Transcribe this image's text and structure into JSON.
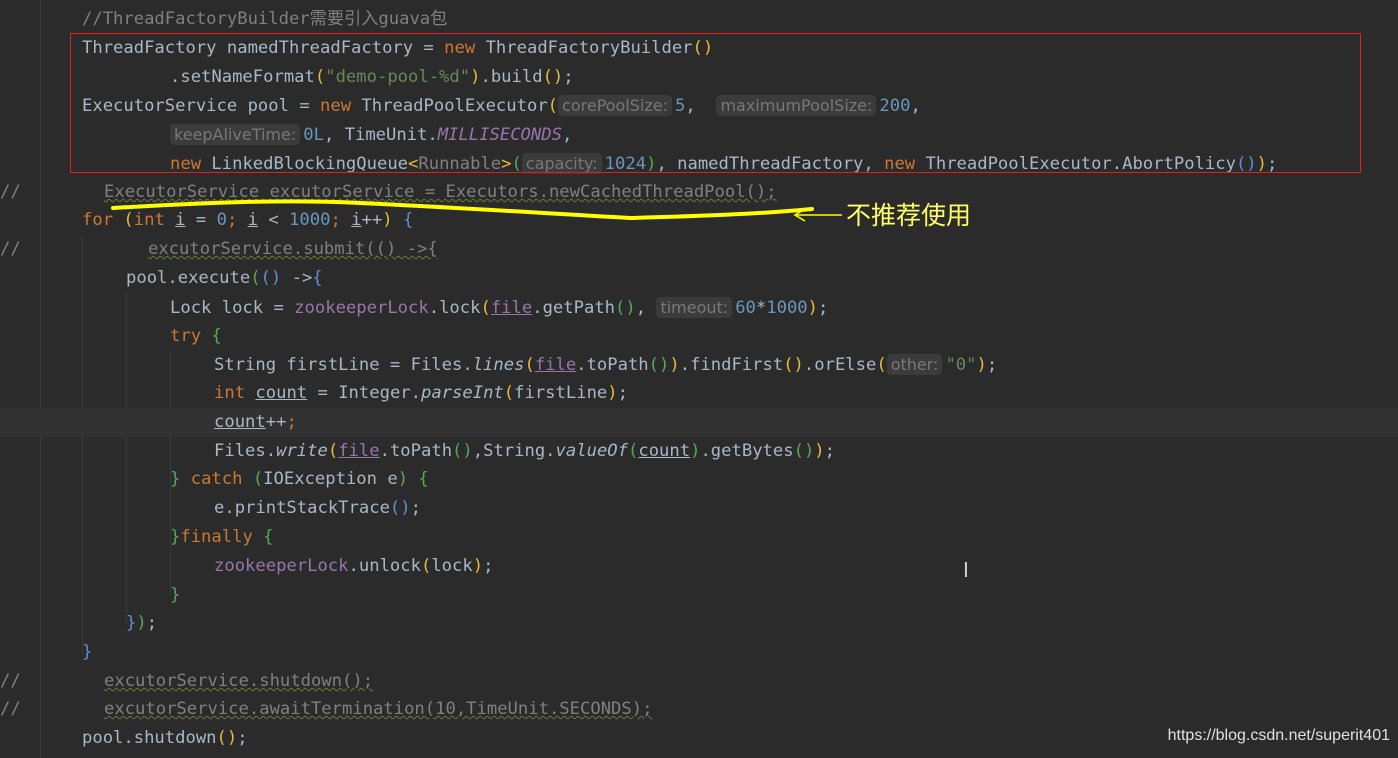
{
  "editor": {
    "lines": [
      {
        "id": "l1",
        "gutter": "",
        "tokens": [
          [
            "c",
            "//ThreadFactoryBuilder需要引入guava包"
          ]
        ]
      },
      {
        "id": "l2",
        "gutter": "",
        "tokens": [
          [
            "t",
            "ThreadFactory namedThreadFactory = "
          ],
          [
            "k",
            "new "
          ],
          [
            "t",
            "ThreadFactoryBuilder"
          ],
          [
            "p1",
            "()"
          ]
        ]
      },
      {
        "id": "l3",
        "gutter": "",
        "tokens": [
          [
            "t",
            ".setNameFormat"
          ],
          [
            "p1",
            "("
          ],
          [
            "s",
            "\"demo-pool-%d\""
          ],
          [
            "p1",
            ")"
          ],
          [
            "t",
            ".build"
          ],
          [
            "p1",
            "()"
          ],
          [
            "t",
            ";"
          ]
        ]
      },
      {
        "id": "l4",
        "gutter": "",
        "tokens": [
          [
            "t",
            "ExecutorService pool = "
          ],
          [
            "k",
            "new "
          ],
          [
            "t",
            "ThreadPoolExecutor"
          ],
          [
            "p1",
            "("
          ],
          [
            "h",
            "corePoolSize:"
          ],
          [
            "n",
            "5"
          ],
          [
            "t",
            ",  "
          ],
          [
            "h",
            "maximumPoolSize:"
          ],
          [
            "n",
            "200"
          ],
          [
            "t",
            ","
          ]
        ]
      },
      {
        "id": "l5",
        "gutter": "",
        "tokens": [
          [
            "h",
            "keepAliveTime:"
          ],
          [
            "n",
            "0L"
          ],
          [
            "t",
            ", TimeUnit."
          ],
          [
            "cst",
            "MILLISECONDS"
          ],
          [
            "t",
            ","
          ]
        ]
      },
      {
        "id": "l6",
        "gutter": "",
        "tokens": [
          [
            "k",
            "new "
          ],
          [
            "t",
            "LinkedBlockingQueue"
          ],
          [
            "p1",
            "<"
          ],
          [
            "c",
            "Runnable"
          ],
          [
            "p1",
            ">"
          ],
          [
            "p2",
            "("
          ],
          [
            "h",
            "capacity:"
          ],
          [
            "n",
            "1024"
          ],
          [
            "p2",
            ")"
          ],
          [
            "t",
            ", namedThreadFactory, "
          ],
          [
            "k",
            "new "
          ],
          [
            "t",
            "ThreadPoolExecutor.AbortPolicy"
          ],
          [
            "p3",
            "()"
          ],
          [
            "p1",
            ")"
          ],
          [
            "t",
            ";"
          ]
        ]
      },
      {
        "id": "l7",
        "gutter": "//",
        "tokens": [
          [
            "c",
            "ExecutorService excutorService = Executors.newCachedThreadPool();"
          ]
        ]
      },
      {
        "id": "l8",
        "gutter": "",
        "tokens": [
          [
            "k",
            "for "
          ],
          [
            "p1",
            "("
          ],
          [
            "k",
            "int "
          ],
          [
            "u",
            "i"
          ],
          [
            "t",
            " = "
          ],
          [
            "n",
            "0"
          ],
          [
            "k",
            "; "
          ],
          [
            "u",
            "i"
          ],
          [
            "t",
            " < "
          ],
          [
            "n",
            "1000"
          ],
          [
            "k",
            "; "
          ],
          [
            "u",
            "i"
          ],
          [
            "t",
            "++"
          ],
          [
            "p1",
            ")"
          ],
          [
            "t",
            " "
          ],
          [
            "p3",
            "{"
          ]
        ]
      },
      {
        "id": "l9",
        "gutter": "//",
        "tokens": [
          [
            "c",
            "excutorService.submit(() ->{"
          ]
        ]
      },
      {
        "id": "l10",
        "gutter": "",
        "tokens": [
          [
            "t",
            "pool.execute"
          ],
          [
            "p2",
            "("
          ],
          [
            "p3",
            "()"
          ],
          [
            "t",
            " ->"
          ],
          [
            "p3",
            "{"
          ]
        ]
      },
      {
        "id": "l11",
        "gutter": "",
        "tokens": [
          [
            "t",
            "Lock lock = "
          ],
          [
            "f",
            "zookeeperLock"
          ],
          [
            "t",
            ".lock"
          ],
          [
            "p1",
            "("
          ],
          [
            "fu",
            "file"
          ],
          [
            "t",
            ".getPath"
          ],
          [
            "p2",
            "()"
          ],
          [
            "t",
            ", "
          ],
          [
            "h",
            "timeout:"
          ],
          [
            "n",
            "60"
          ],
          [
            "t",
            "*"
          ],
          [
            "n",
            "1000"
          ],
          [
            "p1",
            ")"
          ],
          [
            "t",
            ";"
          ]
        ]
      },
      {
        "id": "l12",
        "gutter": "",
        "tokens": [
          [
            "k",
            "try "
          ],
          [
            "p2",
            "{"
          ]
        ]
      },
      {
        "id": "l13",
        "gutter": "",
        "tokens": [
          [
            "t",
            "String firstLine = Files."
          ],
          [
            "it",
            "lines"
          ],
          [
            "p1",
            "("
          ],
          [
            "fu",
            "file"
          ],
          [
            "t",
            ".toPath"
          ],
          [
            "p2",
            "()"
          ],
          [
            "p1",
            ")"
          ],
          [
            "t",
            ".findFirst"
          ],
          [
            "p1",
            "()"
          ],
          [
            "t",
            ".orElse"
          ],
          [
            "p1",
            "("
          ],
          [
            "h",
            "other:"
          ],
          [
            "s",
            "\"0\""
          ],
          [
            "p1",
            ")"
          ],
          [
            "t",
            ";"
          ]
        ]
      },
      {
        "id": "l14",
        "gutter": "",
        "tokens": [
          [
            "k",
            "int "
          ],
          [
            "u",
            "count"
          ],
          [
            "t",
            " = Integer."
          ],
          [
            "it",
            "parseInt"
          ],
          [
            "p1",
            "("
          ],
          [
            "t",
            "firstLine"
          ],
          [
            "p1",
            ")"
          ],
          [
            "t",
            ";"
          ]
        ]
      },
      {
        "id": "l15",
        "gutter": "",
        "tokens": [
          [
            "u",
            "count"
          ],
          [
            "t",
            "++"
          ],
          [
            "k",
            ";"
          ]
        ]
      },
      {
        "id": "l16",
        "gutter": "",
        "tokens": [
          [
            "t",
            "Files."
          ],
          [
            "it",
            "write"
          ],
          [
            "p1",
            "("
          ],
          [
            "fu",
            "file"
          ],
          [
            "t",
            ".toPath"
          ],
          [
            "p2",
            "()"
          ],
          [
            "t",
            ",String."
          ],
          [
            "it",
            "valueOf"
          ],
          [
            "p2",
            "("
          ],
          [
            "u",
            "count"
          ],
          [
            "p2",
            ")"
          ],
          [
            "t",
            ".getBytes"
          ],
          [
            "p2",
            "()"
          ],
          [
            "p1",
            ")"
          ],
          [
            "t",
            ";"
          ]
        ]
      },
      {
        "id": "l17",
        "gutter": "",
        "tokens": [
          [
            "p2",
            "}"
          ],
          [
            "t",
            " "
          ],
          [
            "k",
            "catch "
          ],
          [
            "p2",
            "("
          ],
          [
            "t",
            "IOException e"
          ],
          [
            "p2",
            ")"
          ],
          [
            "t",
            " "
          ],
          [
            "p2",
            "{"
          ]
        ]
      },
      {
        "id": "l18",
        "gutter": "",
        "tokens": [
          [
            "t",
            "e.printStackTrace"
          ],
          [
            "p3",
            "()"
          ],
          [
            "t",
            ";"
          ]
        ]
      },
      {
        "id": "l19",
        "gutter": "",
        "tokens": [
          [
            "p2",
            "}"
          ],
          [
            "k",
            "finally "
          ],
          [
            "p2",
            "{"
          ]
        ]
      },
      {
        "id": "l20",
        "gutter": "",
        "tokens": [
          [
            "f",
            "zookeeperLock"
          ],
          [
            "t",
            ".unlock"
          ],
          [
            "p1",
            "("
          ],
          [
            "t",
            "lock"
          ],
          [
            "p1",
            ")"
          ],
          [
            "t",
            ";"
          ]
        ]
      },
      {
        "id": "l21",
        "gutter": "",
        "tokens": [
          [
            "p2",
            "}"
          ]
        ]
      },
      {
        "id": "l22",
        "gutter": "",
        "tokens": [
          [
            "p3",
            "}"
          ],
          [
            "p2",
            ")"
          ],
          [
            "t",
            ";"
          ]
        ]
      },
      {
        "id": "l23",
        "gutter": "",
        "tokens": [
          [
            "p3",
            "}"
          ]
        ]
      },
      {
        "id": "l24",
        "gutter": "//",
        "tokens": [
          [
            "c",
            "excutorService.shutdown();"
          ]
        ]
      },
      {
        "id": "l25",
        "gutter": "//",
        "tokens": [
          [
            "c",
            "excutorService.awaitTermination(10,TimeUnit.SECONDS);"
          ]
        ]
      },
      {
        "id": "l26",
        "gutter": "",
        "tokens": [
          [
            "t",
            "pool.shutdown"
          ],
          [
            "p1",
            "()"
          ],
          [
            "t",
            ";"
          ]
        ]
      }
    ]
  },
  "annotation": {
    "text": "不推荐使用",
    "color": "#ffff66"
  },
  "watermark": "https://blog.csdn.net/superit401",
  "colors": {
    "background": "#2b2b2b",
    "keyword": "#cc7832",
    "string": "#6a8759",
    "number": "#6897bb",
    "comment": "#808080",
    "field": "#9876aa",
    "highlight_box": "#e02020"
  }
}
